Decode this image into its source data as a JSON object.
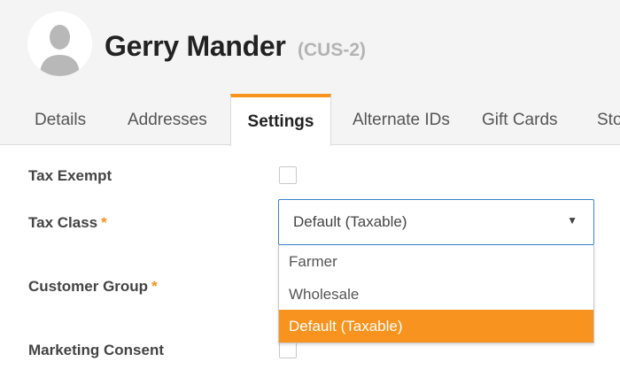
{
  "customer": {
    "name": "Gerry Mander",
    "id_label": "(CUS-2)"
  },
  "tabs": [
    {
      "label": "Details"
    },
    {
      "label": "Addresses"
    },
    {
      "label": "Settings",
      "active": true
    },
    {
      "label": "Alternate IDs"
    },
    {
      "label": "Gift Cards"
    },
    {
      "label": "Sto"
    }
  ],
  "settings": {
    "tax_exempt_label": "Tax Exempt",
    "tax_exempt_checked": false,
    "tax_class_label": "Tax Class",
    "customer_group_label": "Customer Group",
    "marketing_consent_label": "Marketing Consent",
    "marketing_consent_checked": false,
    "required_marker": "*"
  },
  "tax_class_select": {
    "value": "Default (Taxable)",
    "caret_icon": "▼",
    "options": [
      "Farmer",
      "Wholesale",
      "Default (Taxable)"
    ],
    "highlighted_option": "Default (Taxable)"
  },
  "colors": {
    "accent": "#f7931e",
    "focus_border": "#3a83c9"
  }
}
